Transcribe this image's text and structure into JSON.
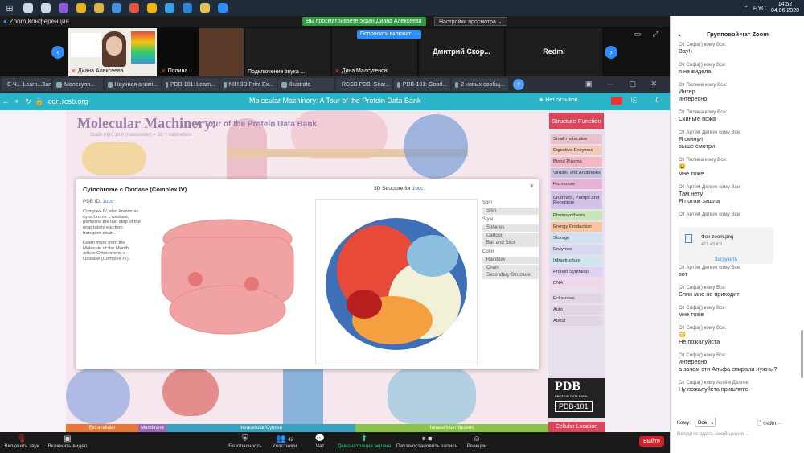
{
  "taskbar": {
    "apps": [
      {
        "name": "search-icon",
        "color": "#cfd8e3"
      },
      {
        "name": "task-view-icon",
        "color": "#cfd8e3"
      },
      {
        "name": "viber-icon",
        "color": "#8e5bd6"
      },
      {
        "name": "chrome-icon",
        "color": "#e8b21f"
      },
      {
        "name": "explorer-icon",
        "color": "#d9b44a"
      },
      {
        "name": "store-icon",
        "color": "#4a90e2"
      },
      {
        "name": "s-app-icon",
        "color": "#e0553c"
      },
      {
        "name": "slides-icon",
        "color": "#f2b705"
      },
      {
        "name": "edge-icon",
        "color": "#3aa0e8"
      },
      {
        "name": "ie-icon",
        "color": "#2f86d6"
      },
      {
        "name": "files-icon",
        "color": "#e0c15a"
      },
      {
        "name": "zoom-icon",
        "color": "#2d8cff"
      }
    ],
    "lang": "РУС",
    "time": "14:52",
    "date": "04.06.2020"
  },
  "zoom": {
    "title": "Zoom Конференция",
    "share_banner": "Вы просматриваете экран Диана Алексеева",
    "view_options": "Настройки просмотра ⌄",
    "ask_enable": "Попросить включить"
  },
  "videos": [
    {
      "name": "Диана Алексеева"
    },
    {
      "name": "Полина"
    },
    {
      "name": "Подключение звука ..."
    },
    {
      "name": "Дина Малсугенов"
    },
    {
      "name": "Дмитрий  Скор..."
    },
    {
      "name": "Redmi"
    }
  ],
  "tabs": [
    "Е-Ч... Learn...Запис...",
    "Молекули...",
    "Научная анимі...",
    "PDB-101: Learn...",
    "NIH 3D Print Ex...",
    "Illustrate",
    "RCSB PDB: Sear...",
    "PDB-101: Good...",
    "2 новых сообщ..."
  ],
  "address": {
    "url": "cdn.rcsb.org",
    "title": "Molecular Machinery: A Tour of the Protein Data Bank",
    "stories": "★ Нет отзывов"
  },
  "poster": {
    "title": "Molecular Machinery:",
    "subtitle": "A Tour of the Protein Data Bank",
    "scale": "Scale (nm)     1nm (nanometer) = 10⁻⁹ millimeters"
  },
  "menu": {
    "header": "Structure Function",
    "items": [
      {
        "label": "Small molecules",
        "color": "#e8c2c8"
      },
      {
        "label": "Digestive Enzymes",
        "color": "#f3c9b8"
      },
      {
        "label": "Blood Plasma",
        "color": "#f6b7c4"
      },
      {
        "label": "Viruses and Antibodies",
        "color": "#c8c0e0"
      },
      {
        "label": "Hormones",
        "color": "#e6b3d6"
      },
      {
        "label": "Channels, Pumps and Receptors",
        "color": "#d2c2e6"
      },
      {
        "label": "Photosynthesis",
        "color": "#c9e6b8"
      },
      {
        "label": "Energy Production",
        "color": "#f7c6a0"
      },
      {
        "label": "Storage",
        "color": "#cfe0f0"
      },
      {
        "label": "Enzymes",
        "color": "#d8d8f0"
      },
      {
        "label": "Infrastructure",
        "color": "#cfe6ef"
      },
      {
        "label": "Protein Synthesis",
        "color": "#e0d0f2"
      },
      {
        "label": "DNA",
        "color": "#f0d8e8"
      }
    ],
    "extra": [
      "Fullscreen",
      "Auto",
      "About"
    ],
    "cell_location": "Cellular Location"
  },
  "legend": [
    {
      "label": "Extracellular",
      "color": "#e8773a"
    },
    {
      "label": "Membrane",
      "color": "#9b6bbb"
    },
    {
      "label": "Intracellular/Cytosol",
      "color": "#3aa4c0"
    },
    {
      "label": "Intracellular/Nucleus",
      "color": "#8bc34a"
    }
  ],
  "modal": {
    "title": "Cytochrome c Oxidase (Complex IV)",
    "pdb_label": "PDB ID:",
    "pdb_id": "1occ",
    "description": "Complex IV, also known as cytochrome c oxidase, performs the last step of the respiratory electron transport chain.",
    "learn_more": "Learn more from the Molecule of the Month article Cytochrome c Oxidase (Complex IV).",
    "viewer_title": "3D Structure for",
    "viewer_id": "1occ",
    "close": "×",
    "controls": [
      {
        "type": "label",
        "text": "Spin"
      },
      {
        "type": "button",
        "text": "Spin"
      },
      {
        "type": "label",
        "text": "Style"
      },
      {
        "type": "button",
        "text": "Spheres"
      },
      {
        "type": "button",
        "text": "Cartoon"
      },
      {
        "type": "button",
        "text": "Ball and Stick"
      },
      {
        "type": "label",
        "text": "Color"
      },
      {
        "type": "button",
        "text": "Rainbow"
      },
      {
        "type": "button",
        "text": "Chain"
      },
      {
        "type": "button",
        "text": "Secondary Structure"
      }
    ]
  },
  "logo": {
    "text": "PDB",
    "small": "PROTEIN DATA BANK",
    "sub": "PDB-101"
  },
  "bottom": [
    "Включить звук",
    "Включить видео",
    "Безопасность",
    "Участники",
    "Чат",
    "Демонстрация экрана",
    "Пауза/остановить запись",
    "Реакции"
  ],
  "participants_count": "42",
  "leave": "Выйти",
  "chat": {
    "title": "Групповой чат Zoom",
    "messages": [
      {
        "from": "От Софа() кому Все:",
        "text": "Вау!)"
      },
      {
        "from": "От Софа() кому Все:",
        "text": "я не видела"
      },
      {
        "from": "От Полина кому Все:",
        "text": "Интер\nинтересно"
      },
      {
        "from": "От Полина кому Все:",
        "text": "Скиньте пожа"
      },
      {
        "from": "От Артём Делгик кому Все:",
        "text": "Я скинул\nвыше смотри"
      },
      {
        "from": "От Полина кому Все:",
        "text": "😀\nмне тоже"
      },
      {
        "from": "От Артём Делгик кому Все:",
        "text": "Там нету\nЯ потом зашла"
      },
      {
        "from": "От Артём Делгик кому Все:",
        "text": ""
      },
      {
        "from": "От Артём Делгик кому Все:",
        "text": "вот"
      },
      {
        "from": "От Софа() кому Все:",
        "text": "Блин мне не приходит"
      },
      {
        "from": "От Софа() кому Все:",
        "text": "мне тоже"
      },
      {
        "from": "От Софа() кому Все:",
        "text": "😳\nНе пожалуйста"
      },
      {
        "from": "От Софа() кому Все:",
        "text": "интересно\nа зачем эти Альфа спирали нужны?"
      },
      {
        "from": "От Софа() кому Артём Делгик:",
        "text": "Ну пожалуйста пришлите"
      }
    ],
    "file": {
      "name": "Фон zoom.png",
      "size": "471.43 KB",
      "download": "Загрузить"
    },
    "to_label": "Кому:",
    "to_value": "Все",
    "file_btn": "Файл",
    "placeholder": "Введите здесь сообщение..."
  }
}
